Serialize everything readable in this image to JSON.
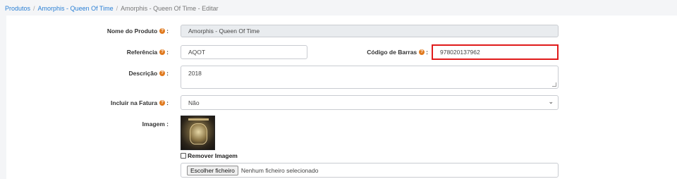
{
  "breadcrumb": {
    "items": [
      "Produtos",
      "Amorphis - Queen Of Time"
    ],
    "current": "Amorphis - Queen Of Time - Editar"
  },
  "form": {
    "nome": {
      "label": "Nome do Produto",
      "value": "Amorphis - Queen Of Time"
    },
    "referencia": {
      "label": "Referência",
      "value": "AQOT"
    },
    "codigo_barras": {
      "label": "Código de Barras",
      "value": "978020137962"
    },
    "descricao": {
      "label": "Descrição",
      "value": "2018"
    },
    "fatura": {
      "label": "Incluir na Fatura",
      "value": "Não"
    },
    "imagem": {
      "label": "Imagem :"
    },
    "remover": {
      "label": "Remover Imagem"
    },
    "ficheiro": {
      "button": "Escolher ficheiro",
      "status": "Nenhum ficheiro selecionado"
    }
  },
  "ui": {
    "help_glyph": "?",
    "colon": ":",
    "select_glyph": "⌄"
  },
  "colors": {
    "accent": "#2a7fd4",
    "help": "#e07a1f",
    "highlight": "#e01b1b"
  }
}
